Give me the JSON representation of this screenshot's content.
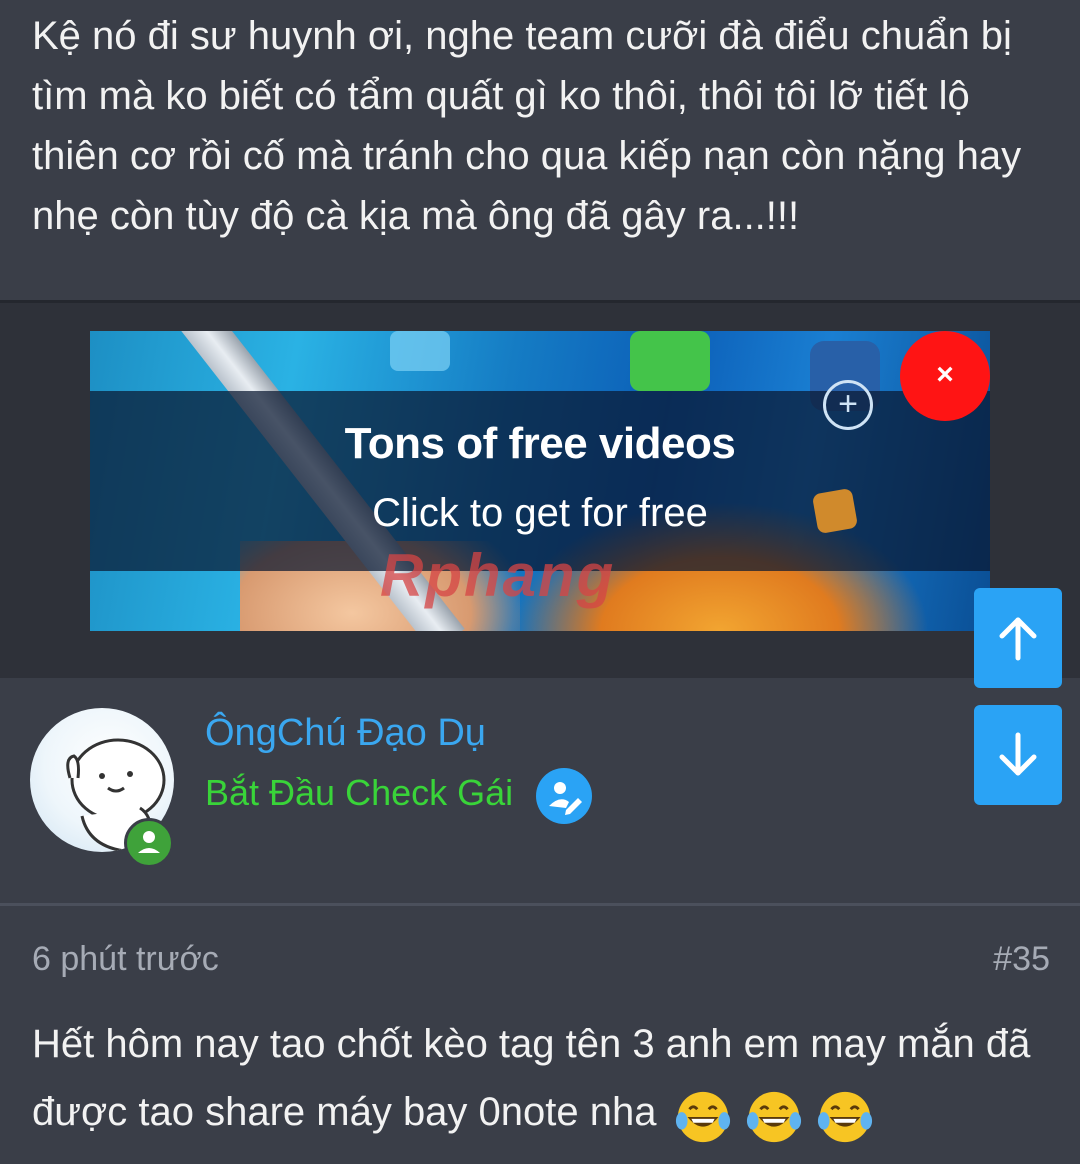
{
  "post_prev": {
    "text": "Kệ nó đi sư huynh ơi, nghe team cưỡi đà điểu chuẩn bị tìm mà ko biết có tẩm quất gì ko thôi, thôi tôi lỡ tiết lộ thiên cơ rồi cố mà tránh cho qua kiếp nạn còn nặng hay nhẹ còn tùy độ cà kịa mà ông đã gây ra...!!!"
  },
  "ad": {
    "title": "Tons of free videos",
    "subtitle": "Click to get for free",
    "watermark": "Rphang",
    "close_label": "×",
    "close_color": "#ff1414"
  },
  "author": {
    "name": "ÔngChú Đạo Dụ",
    "title": "Bắt Đầu Check Gái",
    "name_color": "#3aa7f0",
    "title_color": "#39d439",
    "online_icon": "user-online-icon",
    "badge_icon": "edit-pen-icon"
  },
  "post": {
    "time": "6 phút trước",
    "number": "#35",
    "text": "Hết hôm nay tao chốt kèo tag tên 3 anh em may mắn đã được tao share máy bay 0note nha",
    "emojis": [
      "laughing-tears-icon",
      "laughing-tears-icon",
      "laughing-tears-icon"
    ]
  },
  "scroll": {
    "up_icon": "arrow-up-icon",
    "down_icon": "arrow-down-icon",
    "accent": "#2aa3f5"
  }
}
